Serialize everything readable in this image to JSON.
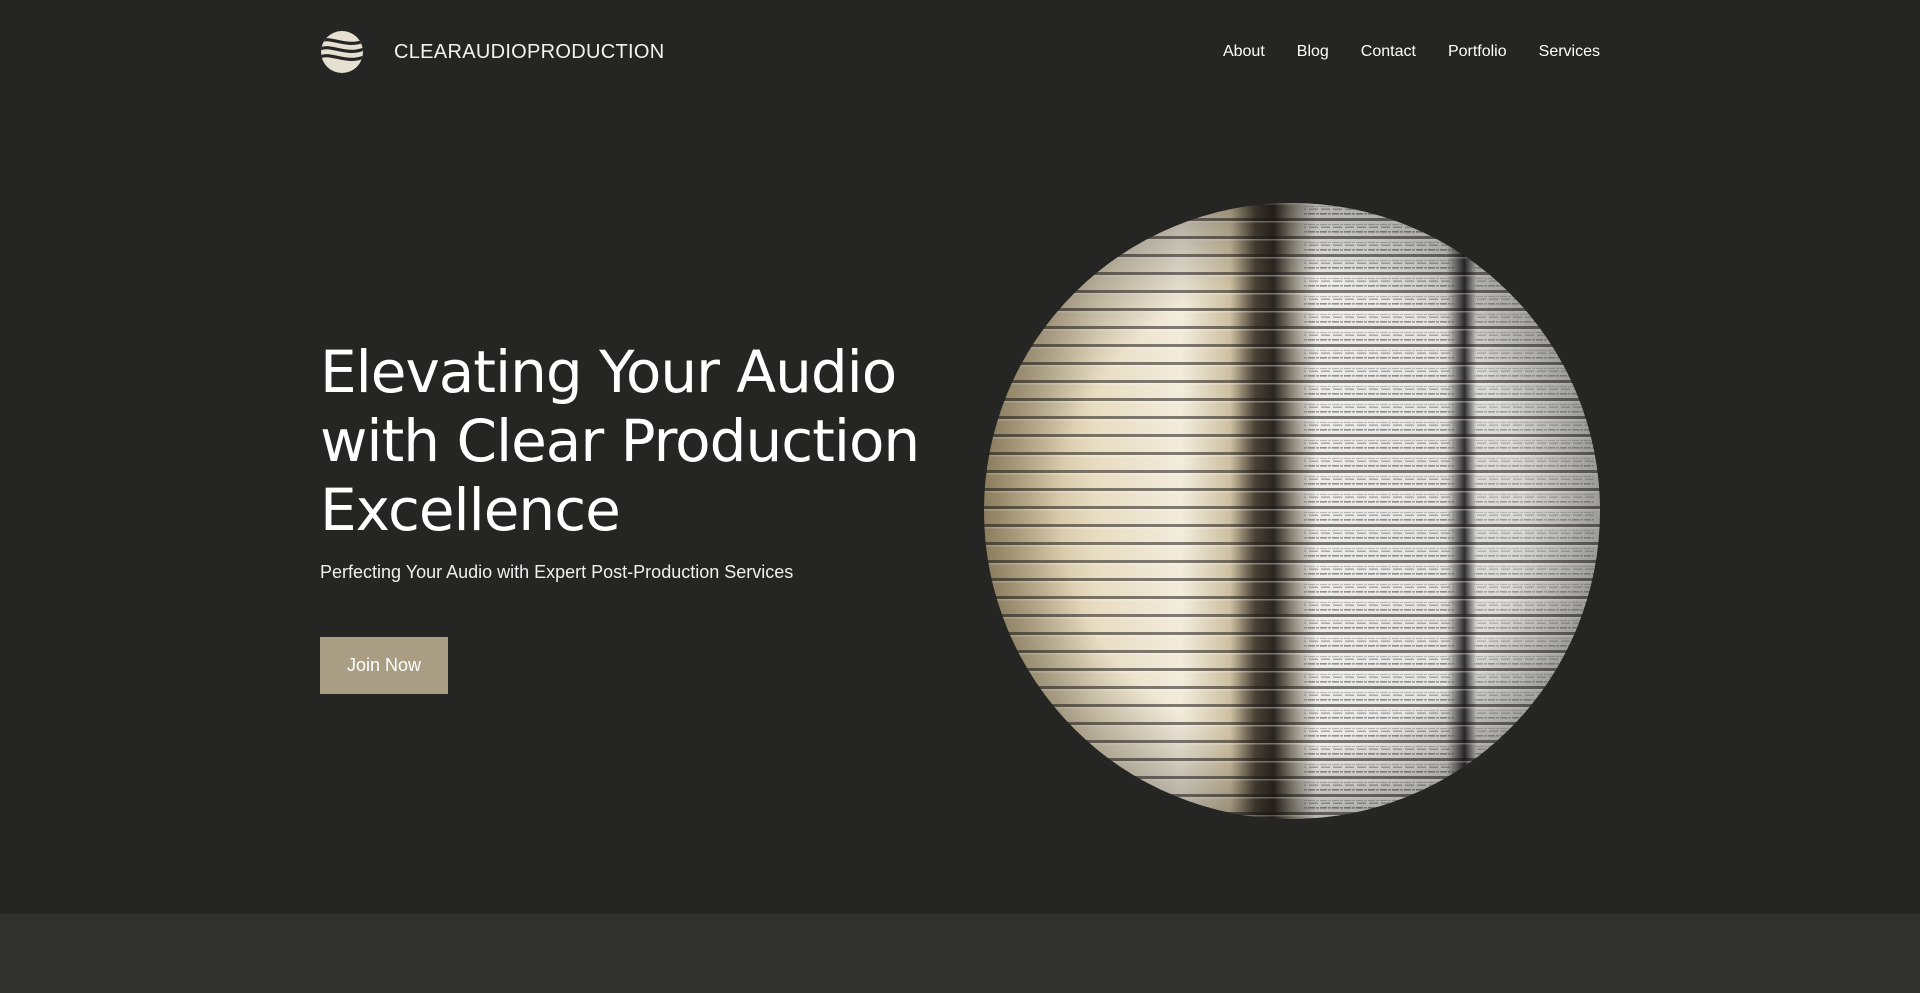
{
  "brand": {
    "name": "CLEARAUDIOPRODUCTION",
    "logo_icon": "wave-circle-logo"
  },
  "nav": {
    "items": [
      "About",
      "Blog",
      "Contact",
      "Portfolio",
      "Services"
    ]
  },
  "hero": {
    "title_lines": [
      "Elevating Your Audio",
      "with Clear Production",
      "Excellence"
    ],
    "subtitle": "Perfecting Your Audio with Expert Post-Production Services",
    "cta_label": "Join Now",
    "image": "stacked-newspapers-photo"
  },
  "colors": {
    "background": "#252523",
    "lower_band": "#31312e",
    "cta": "#a99e84",
    "logo": "#e6e0d3"
  }
}
